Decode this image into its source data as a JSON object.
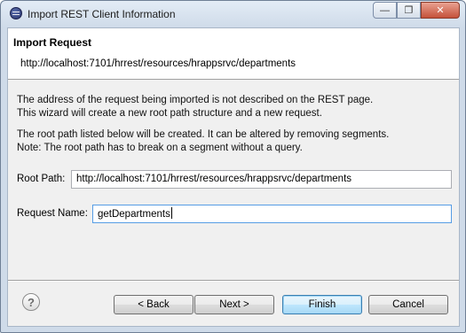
{
  "window": {
    "title": "Import REST Client Information",
    "controls": {
      "minimize": "—",
      "maximize": "❐",
      "close": "✕"
    }
  },
  "header": {
    "title": "Import Request",
    "url": "http://localhost:7101/hrrest/resources/hrappsrvc/departments"
  },
  "messages": {
    "line1": "The address of the request being imported is not described on the REST page.",
    "line2": "This wizard will create a new root path structure and a new request.",
    "line3": "The root path listed below will be created.  It can be altered by removing segments.",
    "line4": "Note: The root path has to break on a segment without a query."
  },
  "fields": {
    "root_path": {
      "label": "Root Path:",
      "value": "http://localhost:7101/hrrest/resources/hrappsrvc/departments"
    },
    "request_name": {
      "label": "Request Name:",
      "value": "getDepartments"
    }
  },
  "buttons": {
    "help": "?",
    "back": "< Back",
    "next": "Next >",
    "finish": "Finish",
    "cancel": "Cancel"
  },
  "icons": {
    "app": "eclipse-icon",
    "help": "help-icon"
  }
}
